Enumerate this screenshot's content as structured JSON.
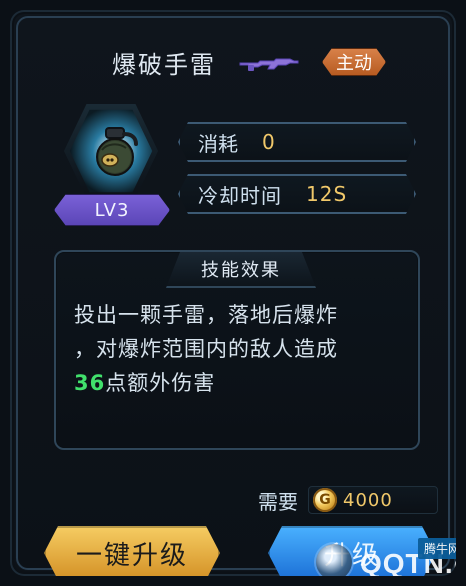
{
  "header": {
    "title": "爆破手雷",
    "tag": "主动",
    "weapon_icon": "rifle-icon"
  },
  "skill": {
    "icon": "grenade-icon",
    "level": "LV3"
  },
  "stats": {
    "cost_label": "消耗",
    "cost_value": "0",
    "cooldown_label": "冷却时间",
    "cooldown_value": "12S"
  },
  "effect": {
    "title": "技能效果",
    "line1": "投出一颗手雷，落地后爆炸",
    "line2": "，对爆炸范围内的敌人造成",
    "line3_prefix": "36",
    "line3_suffix": "点额外伤害"
  },
  "upgrade": {
    "need_label": "需要",
    "coin_symbol": "G",
    "coin_value": "4000",
    "one_click_label": "一键升级",
    "upgrade_label": "升级"
  },
  "watermark": {
    "brand": "QQTN.com",
    "small": "腾牛网"
  }
}
